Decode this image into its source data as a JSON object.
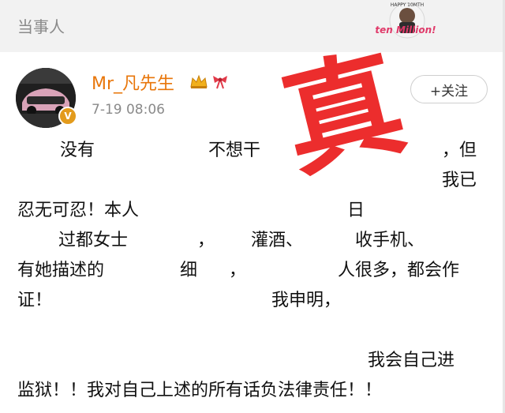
{
  "header": {
    "title": "当事人"
  },
  "sticker": {
    "top_text": "HAPPY 10MTH",
    "main_text": "ten Million!"
  },
  "post": {
    "username": "Mr_凡先生",
    "timestamp": "7-19 08:06",
    "follow_label": "+关注",
    "stamp_text": "真",
    "lines": [
      "没有",
      "不想干",
      "，但",
      "我已",
      "忍无可忍！本人",
      "日",
      "过都女士",
      "，",
      "灌酒、",
      "收手机、",
      "有她描述的",
      "细",
      "，",
      "人很多，都会作",
      "证！",
      "我申明，",
      "我会自己进",
      "监狱！！我对自己上述的所有话负法律责任！！"
    ]
  },
  "colors": {
    "username": "#e8760a",
    "stamp": "#ec2d2d",
    "muted": "#8a8a8a",
    "badge": "#e39b1c"
  }
}
